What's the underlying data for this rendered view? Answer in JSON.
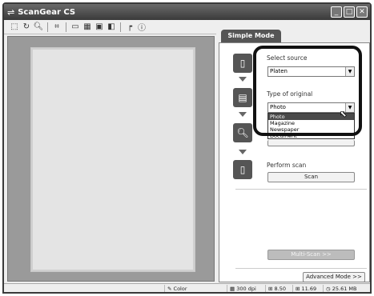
{
  "window": {
    "title": "ScanGear CS",
    "controls": {
      "minimize": "_",
      "maximize": "□",
      "close": "✕"
    }
  },
  "toolbar": {
    "icons": [
      "select-all-frames-icon",
      "rotate-icon",
      "zoom-icon",
      "auto-crop-icon",
      "thumbnail-icon",
      "rotate-left-icon",
      "rotate-right-icon",
      "mirror-icon",
      "flip-icon",
      "info-icon"
    ]
  },
  "tab": {
    "label": "Simple Mode"
  },
  "steps": {
    "select_source": {
      "label": "Select source",
      "value": "Platen"
    },
    "type_of_original": {
      "label": "Type of original",
      "value": "Photo",
      "options": [
        "Photo",
        "Magazine",
        "Newspaper",
        "Document"
      ]
    },
    "perform_scan": {
      "label": "Perform scan",
      "scan_button": "Scan"
    }
  },
  "multiscan_button": "Multi-Scan >>",
  "advanced_button": "Advanced Mode >>",
  "status": {
    "color": "Color",
    "dpi": "300 dpi",
    "width": "8.50",
    "height": "11.69",
    "size": "25.61 MB"
  }
}
